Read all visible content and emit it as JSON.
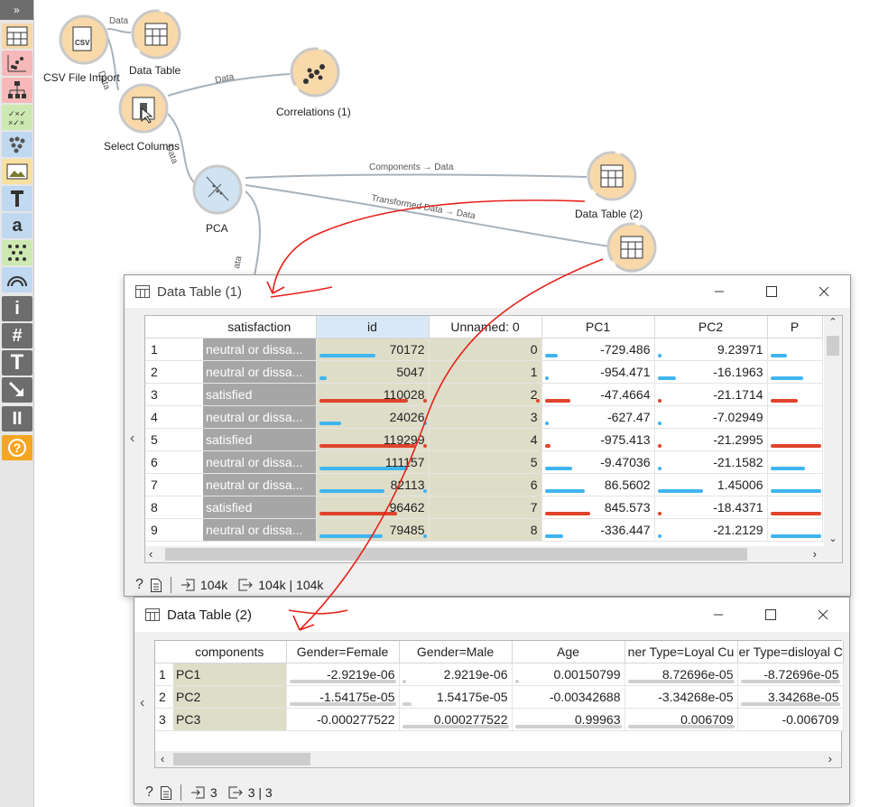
{
  "toolbox": {
    "expand_label": "»",
    "items": [
      {
        "icon": "data-table-icon",
        "color": "#f7d7a8"
      },
      {
        "icon": "scatter-plot-icon",
        "color": "#f6b8b8"
      },
      {
        "icon": "tree-icon",
        "color": "#f6b8b8"
      },
      {
        "icon": "confusion-matrix-icon",
        "color": "#cde8b0"
      },
      {
        "icon": "cluster-icon",
        "color": "#c0d8f0"
      },
      {
        "icon": "image-icon",
        "color": "#f7e0a0"
      },
      {
        "icon": "text-icon",
        "color": "#c0d8f0"
      },
      {
        "icon": "word-icon",
        "color": "#c0d8f0"
      },
      {
        "icon": "network-icon",
        "color": "#cde8b0"
      },
      {
        "icon": "rainbow-icon",
        "color": "#c0d8f0"
      },
      {
        "icon": "info-icon",
        "color": "#6d6d6d"
      },
      {
        "icon": "hash-icon",
        "color": "#6d6d6d"
      },
      {
        "icon": "text-tool-icon",
        "color": "#6d6d6d"
      },
      {
        "icon": "arrow-tool-icon",
        "color": "#6d6d6d"
      },
      {
        "icon": "pause-icon",
        "color": "#6d6d6d"
      },
      {
        "icon": "help-icon",
        "color": "#f5a623"
      }
    ],
    "glyphs": {
      "word": "a",
      "info": "i",
      "hash": "#",
      "text": "T",
      "pause": "II",
      "help": "?"
    }
  },
  "workflow": {
    "nodes": {
      "csv": "CSV File Import",
      "data_table": "Data Table",
      "correlations": "Correlations (1)",
      "select_columns": "Select Columns",
      "pca": "PCA",
      "data_table_2": "Data Table (2)"
    },
    "links": {
      "csv_dt": "Data",
      "csv_sc": "Data",
      "sc_corr": "Data",
      "sc_pca": "Data",
      "pca_components": "Components → Data",
      "pca_transformed": "Transformed Data → Data",
      "pca_other": "ata"
    },
    "annotation_color": "#e8201a"
  },
  "win1": {
    "title": "Data Table (1)",
    "columns": [
      "satisfaction",
      "id",
      "Unnamed: 0",
      "PC1",
      "PC2",
      "P"
    ],
    "rows": [
      {
        "n": "1",
        "sat": "neutral or dissa...",
        "id": "70172",
        "u": "0",
        "pc1": "-729.486",
        "pc2": "9.23971"
      },
      {
        "n": "2",
        "sat": "neutral or dissa...",
        "id": "5047",
        "u": "1",
        "pc1": "-954.471",
        "pc2": "-16.1963"
      },
      {
        "n": "3",
        "sat": "satisfied",
        "id": "110028",
        "u": "2",
        "pc1": "-47.4664",
        "pc2": "-21.1714"
      },
      {
        "n": "4",
        "sat": "neutral or dissa...",
        "id": "24026",
        "u": "3",
        "pc1": "-627.47",
        "pc2": "-7.02949"
      },
      {
        "n": "5",
        "sat": "satisfied",
        "id": "119299",
        "u": "4",
        "pc1": "-975.413",
        "pc2": "-21.2995"
      },
      {
        "n": "6",
        "sat": "neutral or dissa...",
        "id": "111157",
        "u": "5",
        "pc1": "-9.47036",
        "pc2": "-21.1582"
      },
      {
        "n": "7",
        "sat": "neutral or dissa...",
        "id": "82113",
        "u": "6",
        "pc1": "86.5602",
        "pc2": "1.45006"
      },
      {
        "n": "8",
        "sat": "satisfied",
        "id": "96462",
        "u": "7",
        "pc1": "845.573",
        "pc2": "-18.4371"
      },
      {
        "n": "9",
        "sat": "neutral or dissa...",
        "id": "79485",
        "u": "8",
        "pc1": "-336.447",
        "pc2": "-21.2129"
      }
    ],
    "status": {
      "input": "104k",
      "output": "104k | 104k"
    }
  },
  "win2": {
    "title": "Data Table (2)",
    "columns": [
      "components",
      "Gender=Female",
      "Gender=Male",
      "Age",
      "ner Type=Loyal Cu",
      "er Type=disloyal C"
    ],
    "rows": [
      {
        "n": "1",
        "comp": "PC1",
        "gf": "-2.9219e-06",
        "gm": "2.9219e-06",
        "age": "0.00150799",
        "loyal": "8.72696e-05",
        "disloyal": "-8.72696e-05"
      },
      {
        "n": "2",
        "comp": "PC2",
        "gf": "-1.54175e-05",
        "gm": "1.54175e-05",
        "age": "-0.00342688",
        "loyal": "-3.34268e-05",
        "disloyal": "3.34268e-05"
      },
      {
        "n": "3",
        "comp": "PC3",
        "gf": "-0.000277522",
        "gm": "0.000277522",
        "age": "0.99963",
        "loyal": "0.006709",
        "disloyal": "-0.006709"
      }
    ],
    "status": {
      "input": "3",
      "output": "3 | 3"
    }
  },
  "colors": {
    "node_fill": "#f9d9aa",
    "node_ring": "#c9c9c9",
    "pca_fill": "#cfe3f2",
    "bar_blue": "#3fb5f0",
    "bar_red": "#e0432b",
    "meta_gray": "#a6a6a6",
    "id_beige": "#deddc8"
  }
}
